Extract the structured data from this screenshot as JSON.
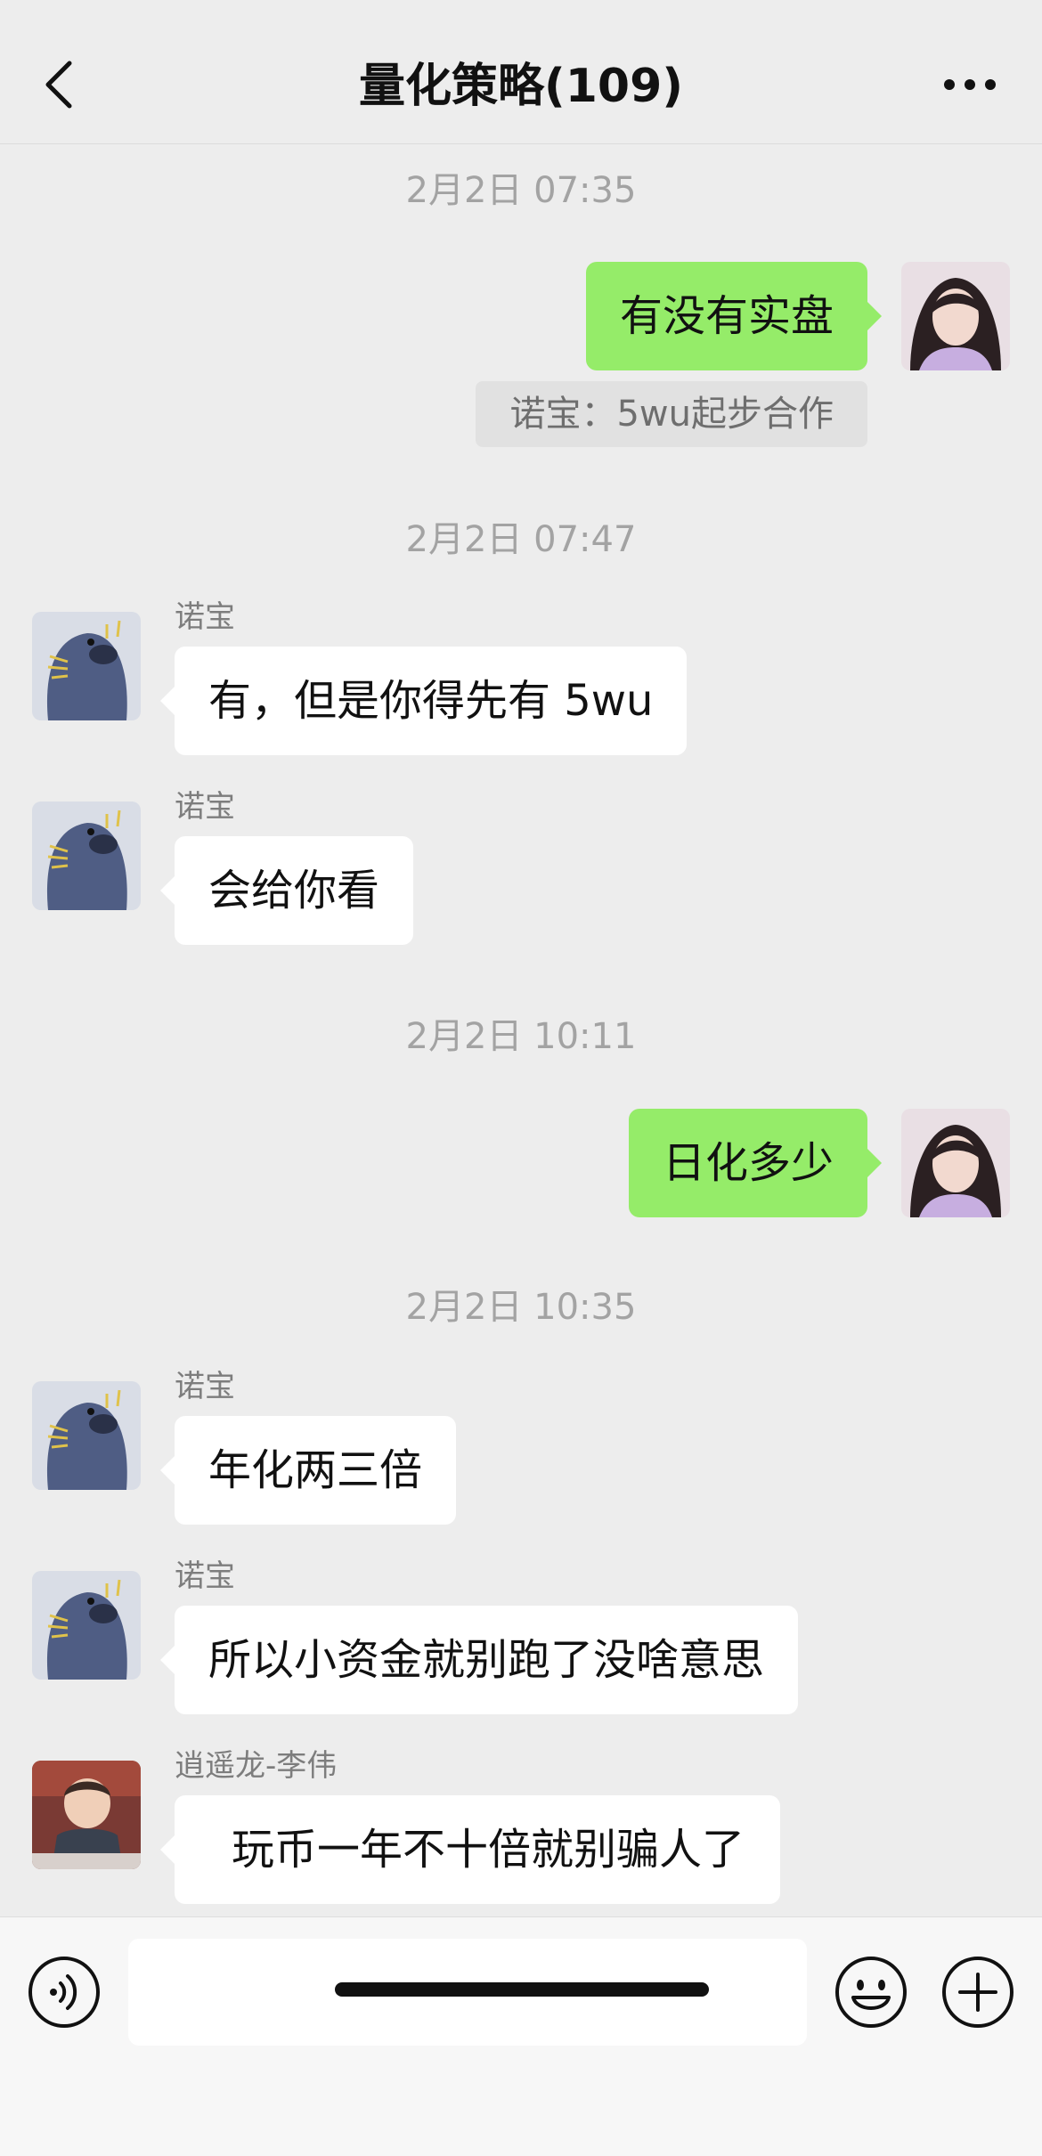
{
  "header": {
    "title": "量化策略(109)",
    "back_icon": "chevron-left-icon",
    "more_icon": "ellipsis-icon"
  },
  "messages": [
    {
      "type": "timestamp",
      "text": "2月2日 07:35"
    },
    {
      "type": "outgoing",
      "text": "有没有实盘",
      "quote": "诺宝：5wu起步合作"
    },
    {
      "type": "timestamp",
      "text": "2月2日 07:47"
    },
    {
      "type": "incoming",
      "sender": "诺宝",
      "text": "有，但是你得先有 5wu"
    },
    {
      "type": "incoming",
      "sender": "诺宝",
      "text": "会给你看"
    },
    {
      "type": "timestamp",
      "text": "2月2日 10:11"
    },
    {
      "type": "outgoing",
      "text": "日化多少"
    },
    {
      "type": "timestamp",
      "text": "2月2日 10:35"
    },
    {
      "type": "incoming",
      "sender": "诺宝",
      "text": "年化两三倍"
    },
    {
      "type": "incoming",
      "sender": "诺宝",
      "text": "所以小资金就别跑了没啥意思"
    },
    {
      "type": "incoming",
      "sender": "逍遥龙-李伟",
      "text": "玩币一年不十倍就别骗人了"
    }
  ],
  "input_bar": {
    "voice_icon": "voice-icon",
    "emoji_icon": "emoji-icon",
    "plus_icon": "plus-icon",
    "input_value": ""
  },
  "colors": {
    "background": "#ededed",
    "outgoing_bubble": "#95ec69",
    "incoming_bubble": "#ffffff"
  }
}
